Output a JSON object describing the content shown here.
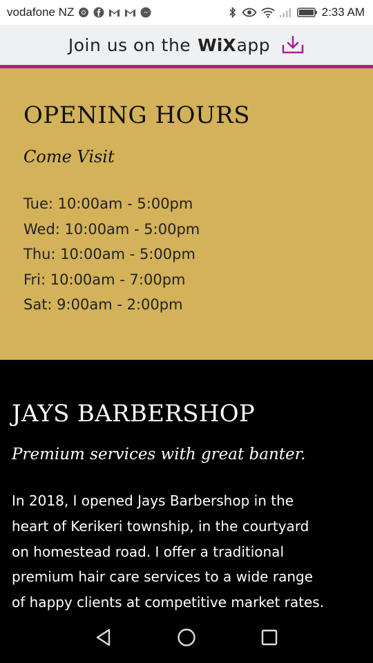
{
  "status_bar": {
    "carrier": "vodafone NZ",
    "time": "2:33 AM",
    "left_icons": [
      "chrome-icon",
      "facebook-icon",
      "gmail-icon",
      "gmail-icon",
      "messenger-icon"
    ],
    "right_icons": [
      "bluetooth-icon",
      "eye-comfort-icon",
      "wifi-icon",
      "signal-icon",
      "battery-icon"
    ]
  },
  "wix_banner": {
    "prefix": "Join us on the",
    "brand": "WiX",
    "suffix": "app",
    "accent_color": "#a4248f"
  },
  "hours": {
    "title": "OPENING HOURS",
    "subtitle": "Come Visit",
    "items": [
      "Tue: 10:00am - 5:00pm",
      "Wed: 10:00am - 5:00pm",
      "Thu: 10:00am - 5:00pm",
      "Fri: 10:00am - 7:00pm",
      "Sat: 9:00am - 2:00pm"
    ],
    "background": "#d3b25a"
  },
  "about": {
    "title": "JAYS BARBERSHOP",
    "tagline": "Premium services with great banter.",
    "lines": [
      "In 2018, I opened Jays Barbershop in the",
      "heart of Kerikeri township, in the courtyard",
      "on homestead road. I offer a traditional",
      "premium hair care services to a wide range",
      "of happy clients at competitive market rates."
    ],
    "background": "#000000"
  },
  "nav_bar": {
    "buttons": [
      "back-icon",
      "home-icon",
      "recents-icon"
    ]
  }
}
